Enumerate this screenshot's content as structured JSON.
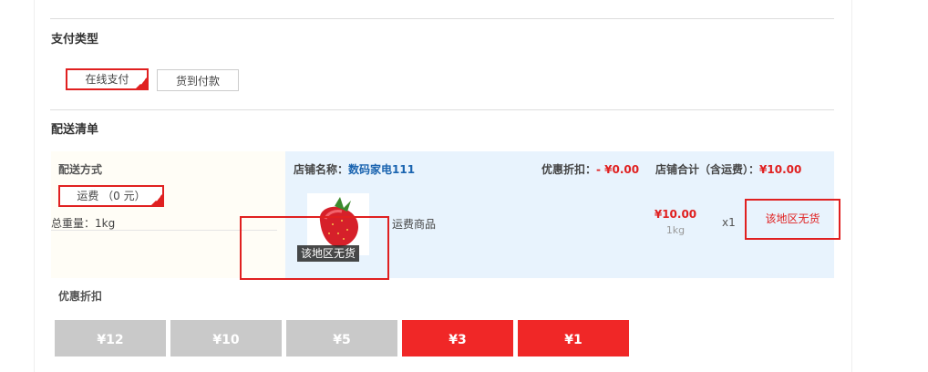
{
  "payment": {
    "title": "支付类型",
    "options": [
      {
        "label": "在线支付",
        "selected": true
      },
      {
        "label": "货到付款",
        "selected": false
      }
    ]
  },
  "delivery": {
    "title": "配送清单",
    "method_label": "配送方式",
    "fee_option": "运费 （0 元）",
    "total_weight": "总重量：1kg"
  },
  "shop": {
    "name_label": "店铺名称：",
    "name": "数码家电111",
    "discount_label": "优惠折扣：",
    "discount_value": "- ¥0.00",
    "total_label": "店铺合计（含运费）：",
    "total_value": "¥10.00"
  },
  "item": {
    "image_icon": "strawberry-image",
    "unavailable_overlay": "该地区无货",
    "name": "运费商品",
    "price": "¥10.00",
    "weight": "1kg",
    "quantity": "x1",
    "status": "该地区无货"
  },
  "coupons": {
    "title": "优惠折扣",
    "items": [
      {
        "label": "¥12",
        "active": false
      },
      {
        "label": "¥10",
        "active": false
      },
      {
        "label": "¥5",
        "active": false
      },
      {
        "label": "¥3",
        "active": true
      },
      {
        "label": "¥1",
        "active": true
      }
    ]
  },
  "colors": {
    "accent": "#e02020",
    "shop_bar": "#e8f3fd",
    "coupon_gray": "#c9c9c9",
    "coupon_red": "#f02727"
  }
}
